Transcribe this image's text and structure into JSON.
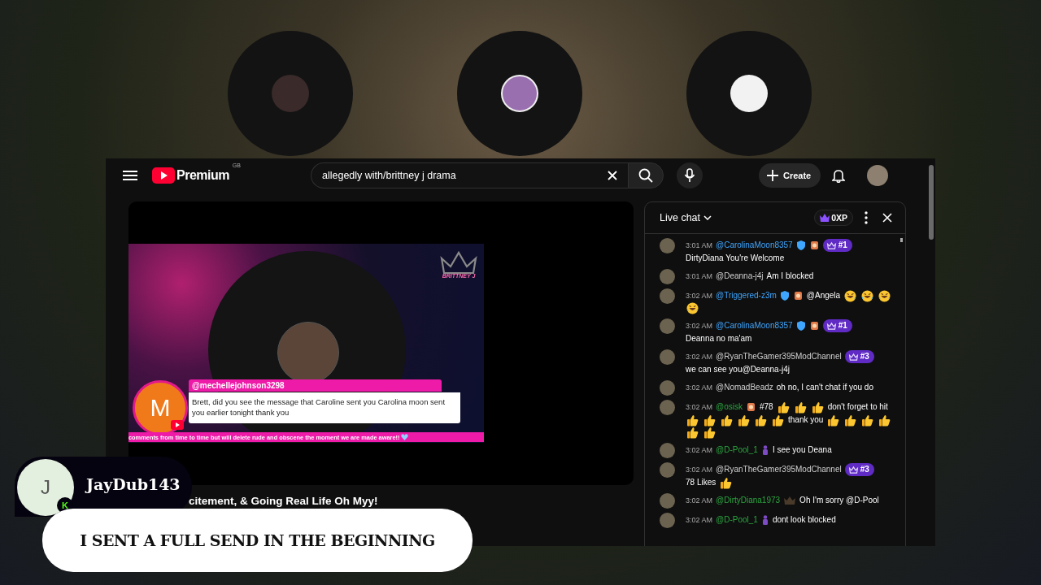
{
  "topbar": {
    "logo_text": "Premium",
    "region": "GB",
    "search": {
      "value": "allegedly with/brittney j drama"
    },
    "create_label": "Create"
  },
  "video": {
    "overlay": {
      "logo_text": "BRITTNEY J",
      "comment": {
        "initial": "M",
        "author": "@mechellejohnson3298",
        "text": "Brett, did you see the message that Caroline sent you Carolina moon sent you earlier tonight thank you"
      },
      "ticker": "comments from time to time but will delete rude and obscene the moment we are made aware!!"
    },
    "title": "citement, & Going Real Life Oh Myy!"
  },
  "chat": {
    "title": "Live chat",
    "xp": "0XP",
    "messages": [
      {
        "time": "3:01 AM",
        "author": "@CarolinaMoon8357",
        "kind": "verified",
        "badges": [
          {
            "kind": "shield"
          },
          {
            "kind": "sticker"
          },
          {
            "kind": "rank",
            "text": "#1"
          }
        ],
        "parts": [
          {
            "kind": "text",
            "text": "DirtyDiana You're Welcome"
          }
        ]
      },
      {
        "time": "3:01 AM",
        "author": "@Deanna-j4j",
        "kind": "plain",
        "parts": [
          {
            "kind": "text",
            "text": "Am I blocked"
          }
        ]
      },
      {
        "time": "3:02 AM",
        "author": "@Triggered-z3m",
        "kind": "verified",
        "badges": [
          {
            "kind": "shield"
          },
          {
            "kind": "sticker"
          }
        ],
        "parts": [
          {
            "kind": "text",
            "text": "@Angela"
          },
          {
            "kind": "laugh"
          },
          {
            "kind": "laugh"
          },
          {
            "kind": "laugh"
          },
          {
            "kind": "laugh"
          }
        ]
      },
      {
        "time": "3:02 AM",
        "author": "@CarolinaMoon8357",
        "kind": "verified",
        "badges": [
          {
            "kind": "shield"
          },
          {
            "kind": "sticker"
          },
          {
            "kind": "rank",
            "text": "#1"
          }
        ],
        "parts": [
          {
            "kind": "text",
            "text": "Deanna no ma'am"
          }
        ]
      },
      {
        "time": "3:02 AM",
        "author": "@RyanTheGamer395ModChannel",
        "kind": "plain",
        "badges": [
          {
            "kind": "rank",
            "text": "#3"
          }
        ],
        "parts": [
          {
            "kind": "text",
            "text": "we can see you@Deanna-j4j"
          }
        ]
      },
      {
        "time": "3:02 AM",
        "author": "@NomadBeadz",
        "kind": "plain",
        "parts": [
          {
            "kind": "text",
            "text": "oh no, I can't chat if you do"
          }
        ]
      },
      {
        "time": "3:02 AM",
        "author": "@osisk",
        "kind": "member",
        "badges": [
          {
            "kind": "sticker"
          }
        ],
        "parts": [
          {
            "kind": "text",
            "text": "#78"
          },
          {
            "kind": "thumb"
          },
          {
            "kind": "thumb"
          },
          {
            "kind": "thumb"
          },
          {
            "kind": "text",
            "text": "don't forget to hit"
          },
          {
            "kind": "thumb"
          },
          {
            "kind": "thumb"
          },
          {
            "kind": "thumb"
          },
          {
            "kind": "thumb"
          },
          {
            "kind": "thumb"
          },
          {
            "kind": "thumb"
          },
          {
            "kind": "text",
            "text": "thank you"
          },
          {
            "kind": "thumb"
          },
          {
            "kind": "thumb"
          },
          {
            "kind": "thumb"
          },
          {
            "kind": "thumb"
          },
          {
            "kind": "thumb"
          },
          {
            "kind": "thumb"
          }
        ]
      },
      {
        "time": "3:02 AM",
        "author": "@D-Pool_1",
        "kind": "member",
        "badges": [
          {
            "kind": "figure"
          }
        ],
        "parts": [
          {
            "kind": "text",
            "text": "I see you Deana"
          }
        ]
      },
      {
        "time": "3:02 AM",
        "author": "@RyanTheGamer395ModChannel",
        "kind": "plain",
        "badges": [
          {
            "kind": "rank",
            "text": "#3"
          }
        ],
        "parts": [
          {
            "kind": "text",
            "text": "78 Likes"
          },
          {
            "kind": "thumb"
          }
        ]
      },
      {
        "time": "3:02 AM",
        "author": "@DirtyDiana1973",
        "kind": "member",
        "badges": [
          {
            "kind": "crownmark"
          }
        ],
        "parts": [
          {
            "kind": "text",
            "text": "Oh I'm sorry @D-Pool"
          }
        ]
      },
      {
        "time": "3:02 AM",
        "author": "@D-Pool_1",
        "kind": "member",
        "badges": [
          {
            "kind": "figure"
          }
        ],
        "parts": [
          {
            "kind": "text",
            "text": "dont look blocked"
          }
        ]
      }
    ]
  },
  "alert": {
    "initial": "J",
    "platform_mark": "K",
    "name": "JayDub143",
    "message": "I SENT A FULL SEND IN THE BEGINNING"
  }
}
